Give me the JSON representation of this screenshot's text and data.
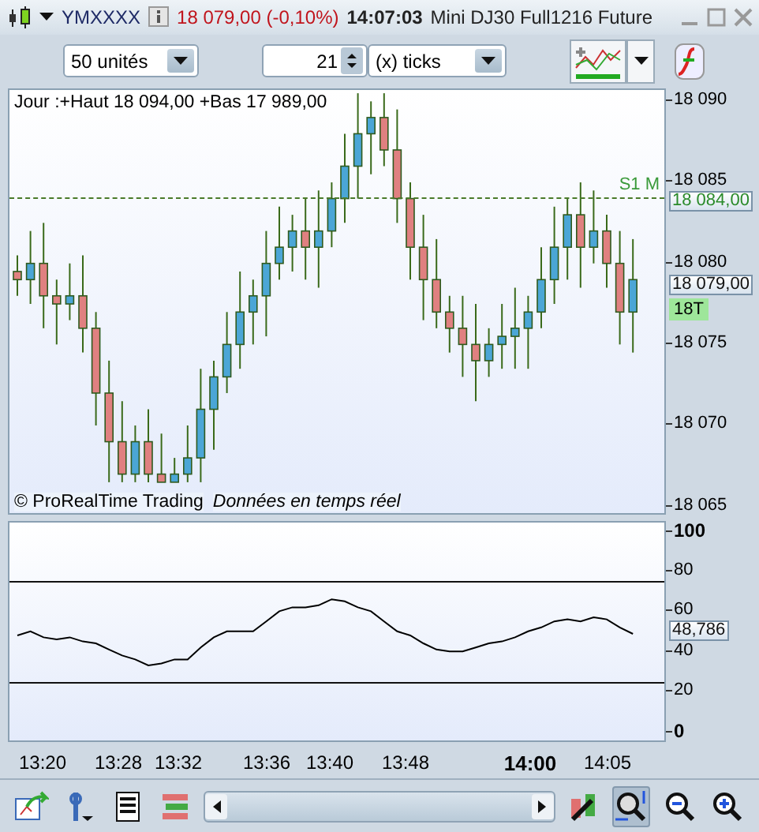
{
  "window": {
    "symbol": "YMXXXX",
    "price": "18 079,00 (-0,10%)",
    "time": "14:07:03",
    "instrument": "Mini DJ30 Full1216 Future"
  },
  "toolbar": {
    "units": "50 unités",
    "period_count": "21",
    "period_unit": "(x) ticks"
  },
  "price_chart": {
    "info": "Jour :+Haut 18 094,00 +Bas 17 989,00",
    "copyright": "© ProRealTime Trading",
    "data_note": "Données en temps réel",
    "level_line": {
      "label": "S1 M",
      "tag": "18 084,00"
    },
    "last_price": "18 079,00",
    "tick_badge": "18T",
    "chart_data": {
      "type": "candlestick",
      "ylim": [
        18064.4,
        18090.7
      ],
      "ref_lines": [
        {
          "axis": "y",
          "value": 18084
        }
      ],
      "yticks": [
        {
          "value": 18090,
          "label": "18 090"
        },
        {
          "value": 18085,
          "label": "18 085"
        },
        {
          "value": 18080,
          "label": "18 080"
        },
        {
          "value": 18075,
          "label": "18 075"
        },
        {
          "value": 18070,
          "label": "18 070"
        },
        {
          "value": 18065,
          "label": "18 065"
        }
      ],
      "ohlc": [
        [
          18079.5,
          18080.5,
          18078,
          18079
        ],
        [
          18079,
          18082,
          18077.5,
          18080
        ],
        [
          18080,
          18082.5,
          18076,
          18078
        ],
        [
          18078,
          18079,
          18075,
          18077.5
        ],
        [
          18077.5,
          18080,
          18076.5,
          18078
        ],
        [
          18078,
          18080.5,
          18074.5,
          18076
        ],
        [
          18076,
          18077,
          18070,
          18072
        ],
        [
          18072,
          18074,
          18066.5,
          18069
        ],
        [
          18069,
          18071.5,
          18066.5,
          18067
        ],
        [
          18067,
          18070,
          18066.5,
          18069
        ],
        [
          18069,
          18071,
          18066.5,
          18067
        ],
        [
          18067,
          18069.5,
          18066.5,
          18066.5
        ],
        [
          18066.5,
          18068,
          18066.5,
          18067
        ],
        [
          18067,
          18070,
          18066.5,
          18068
        ],
        [
          18068,
          18073.5,
          18066.5,
          18071
        ],
        [
          18071,
          18074,
          18068.5,
          18073
        ],
        [
          18073,
          18077,
          18072,
          18075
        ],
        [
          18075,
          18079.5,
          18073.5,
          18077
        ],
        [
          18077,
          18079,
          18075,
          18078
        ],
        [
          18078,
          18082,
          18075.5,
          18080
        ],
        [
          18080,
          18083.5,
          18079,
          18081
        ],
        [
          18081,
          18083,
          18079.5,
          18082
        ],
        [
          18082,
          18084,
          18079,
          18081
        ],
        [
          18081,
          18084.5,
          18078.5,
          18082
        ],
        [
          18082,
          18085,
          18081,
          18084
        ],
        [
          18084,
          18088,
          18082.5,
          18086
        ],
        [
          18086,
          18090.5,
          18084,
          18088
        ],
        [
          18088,
          18090,
          18085.5,
          18089
        ],
        [
          18089,
          18090.5,
          18086,
          18087
        ],
        [
          18087,
          18089.5,
          18082.5,
          18084
        ],
        [
          18084,
          18085,
          18079,
          18081
        ],
        [
          18081,
          18083,
          18076.5,
          18079
        ],
        [
          18079,
          18081.5,
          18076,
          18077
        ],
        [
          18077,
          18078,
          18074.5,
          18076
        ],
        [
          18076,
          18078,
          18073,
          18075
        ],
        [
          18075,
          18077.5,
          18071.5,
          18074
        ],
        [
          18074,
          18076,
          18073,
          18075
        ],
        [
          18075,
          18077.5,
          18073.5,
          18075.5
        ],
        [
          18075.5,
          18078.5,
          18073.5,
          18076
        ],
        [
          18076,
          18078,
          18073.5,
          18077
        ],
        [
          18077,
          18081,
          18076,
          18079
        ],
        [
          18079,
          18083.5,
          18077.5,
          18081
        ],
        [
          18081,
          18084,
          18079,
          18083
        ],
        [
          18083,
          18085,
          18078.5,
          18081
        ],
        [
          18081,
          18084.5,
          18080,
          18082
        ],
        [
          18082,
          18083,
          18078.5,
          18080
        ],
        [
          18080,
          18082,
          18075,
          18077
        ],
        [
          18077,
          18081.5,
          18074.5,
          18079
        ]
      ]
    }
  },
  "oscillator": {
    "reading": "48,786",
    "chart_data": {
      "type": "line",
      "ylim": [
        -5.2,
        104.3
      ],
      "yticks": [
        {
          "value": 0,
          "label": "0"
        },
        {
          "value": 20,
          "label": "20"
        },
        {
          "value": 40,
          "label": "40"
        },
        {
          "value": 60,
          "label": "60"
        },
        {
          "value": 80,
          "label": "80"
        },
        {
          "value": 100,
          "label": "100"
        }
      ],
      "series": [
        {
          "color": "#000000",
          "values": [
            48,
            50,
            47,
            46,
            47,
            45,
            44,
            41,
            38,
            36,
            33,
            34,
            36,
            36,
            42,
            47,
            50,
            50,
            50,
            55,
            60,
            62,
            62,
            63,
            66,
            65,
            62,
            60,
            55,
            50,
            48,
            44,
            41,
            40,
            40,
            42,
            44,
            45,
            47,
            50,
            52,
            55,
            56,
            55,
            57,
            56,
            52,
            48.8
          ]
        }
      ],
      "ref_lines": [
        {
          "axis": "y",
          "value": 75
        },
        {
          "axis": "y",
          "value": 25
        }
      ]
    }
  },
  "time_axis": [
    {
      "label": "13:20",
      "bold": false
    },
    {
      "label": "13:28",
      "bold": false
    },
    {
      "label": "13:32",
      "bold": false
    },
    {
      "label": "13:36",
      "bold": false
    },
    {
      "label": "13:40",
      "bold": false
    },
    {
      "label": "13:48",
      "bold": false
    },
    {
      "label": "14:00",
      "bold": true
    },
    {
      "label": "14:05",
      "bold": false
    }
  ],
  "bottom_toolbar": {
    "zoom_tool_selected": true
  }
}
